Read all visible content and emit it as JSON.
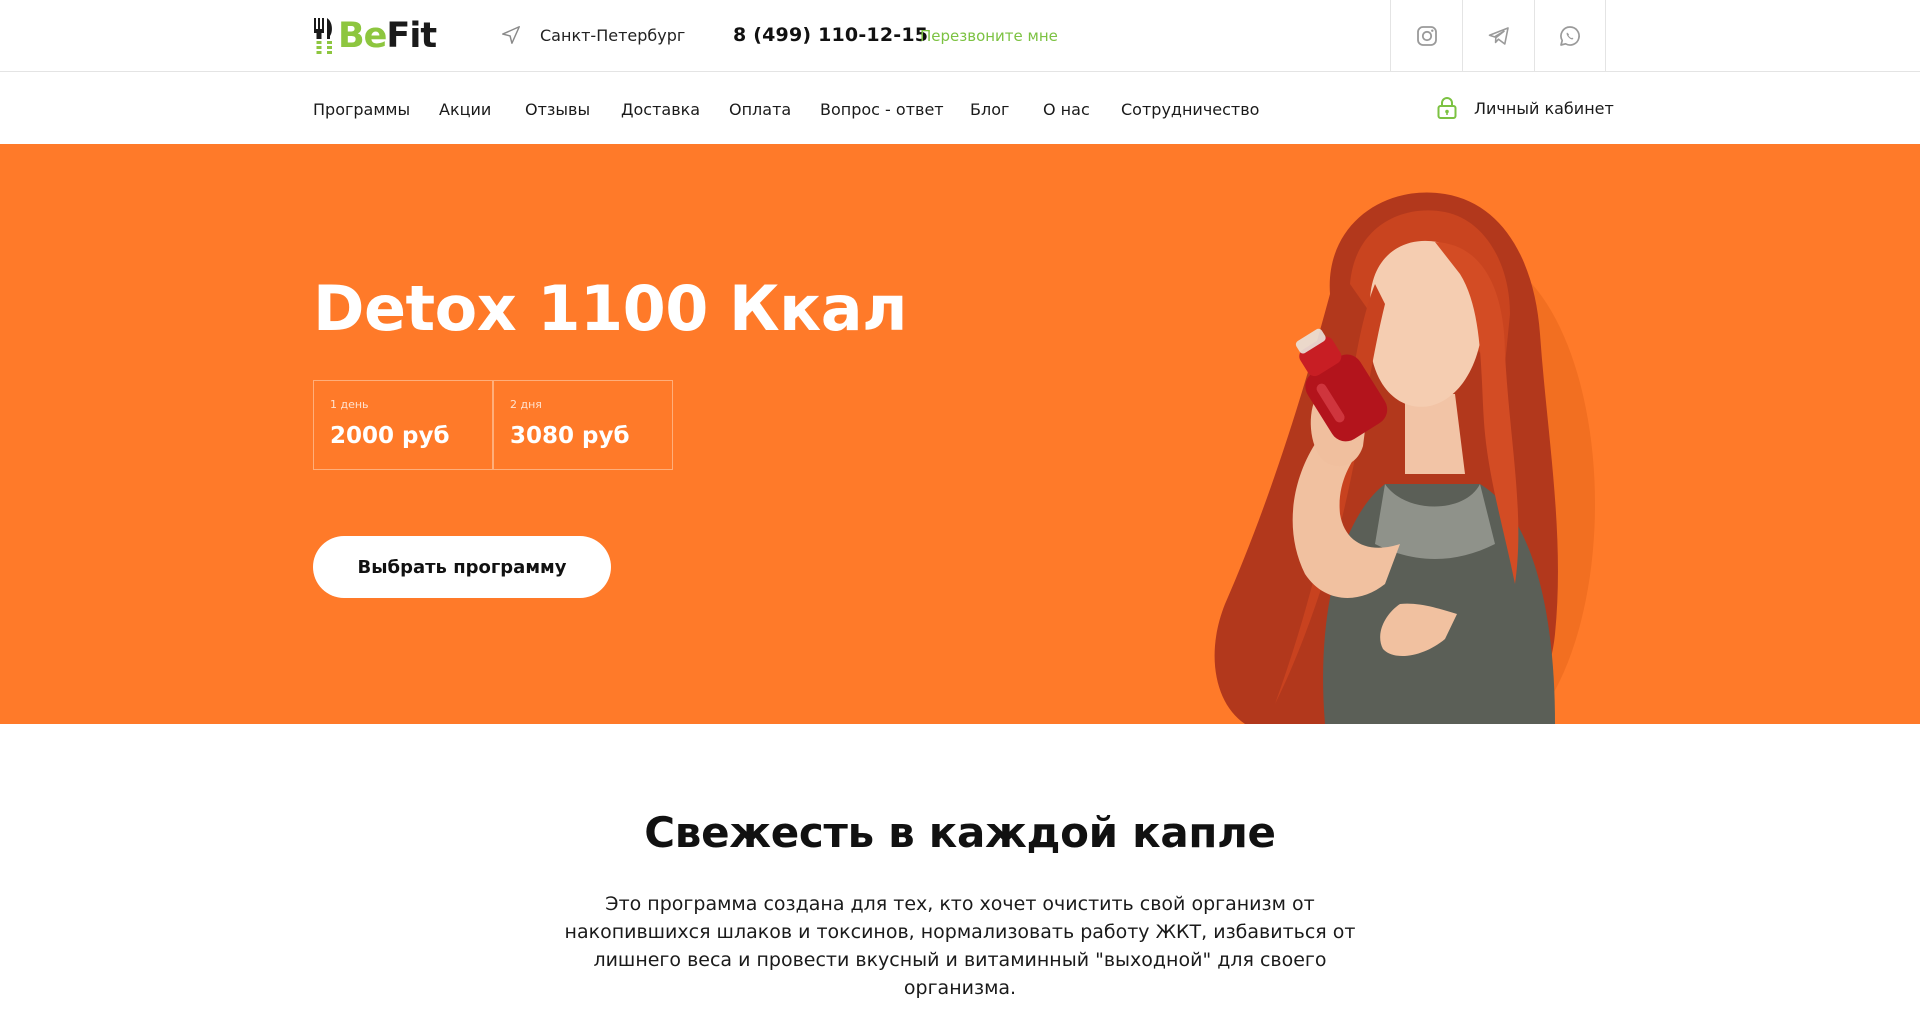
{
  "header": {
    "logo": {
      "be": "Be",
      "fit": "Fit"
    },
    "city": "Санкт-Петербург",
    "phone": "8 (499) 110-12-15",
    "callback": "Перезвоните мне",
    "social": [
      "instagram-icon",
      "telegram-icon",
      "whatsapp-icon"
    ]
  },
  "nav": {
    "items": [
      {
        "label": "Программы"
      },
      {
        "label": "Акции"
      },
      {
        "label": "Отзывы"
      },
      {
        "label": "Доставка"
      },
      {
        "label": "Оплата"
      },
      {
        "label": "Вопрос - ответ"
      },
      {
        "label": "Блог"
      },
      {
        "label": "О нас"
      },
      {
        "label": "Сотрудничество"
      }
    ],
    "cabinet": "Личный кабинет"
  },
  "hero": {
    "title": "Detox 1100 Ккал",
    "prices": [
      {
        "period": "1 день",
        "amount": "2000 руб"
      },
      {
        "period": "2 дня",
        "amount": "3080 руб"
      }
    ],
    "button": "Выбрать программу"
  },
  "section": {
    "title": "Свежесть в каждой капле",
    "text": "Это программа создана для тех, кто хочет очистить свой организм от накопившихся шлаков и токсинов, нормализовать работу ЖКТ, избавиться от лишнего веса и провести вкусный и витаминный \"выходной\" для своего организма."
  },
  "colors": {
    "accent_green": "#7cc242",
    "hero_orange": "#ff7a29",
    "text": "#1a1a1a"
  }
}
